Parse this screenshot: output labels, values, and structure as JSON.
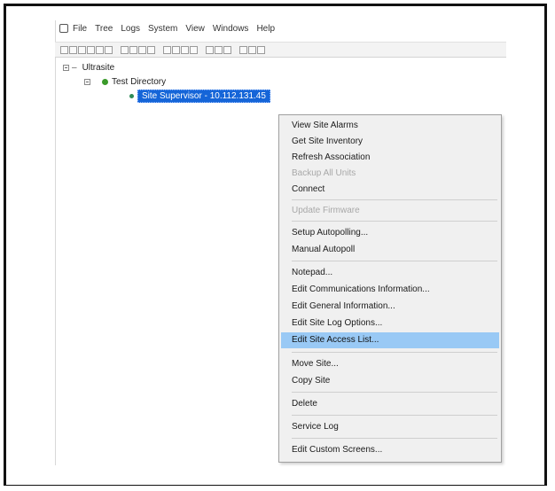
{
  "menubar": {
    "items": [
      "File",
      "Tree",
      "Logs",
      "System",
      "View",
      "Windows",
      "Help"
    ]
  },
  "tree": {
    "root_label": "Ultrasite",
    "folder_label": "Test Directory",
    "selected_label": "Site Supervisor - 10.112.131.45"
  },
  "context_menu": {
    "items": [
      {
        "label": "View Site Alarms",
        "enabled": true
      },
      {
        "label": "Get Site Inventory",
        "enabled": true
      },
      {
        "label": "Refresh Association",
        "enabled": true
      },
      {
        "label": "Backup All Units",
        "enabled": false
      },
      {
        "label": "Connect",
        "enabled": true
      },
      {
        "label": "Update Firmware",
        "enabled": false
      },
      {
        "label": "Setup Autopolling...",
        "enabled": true
      },
      {
        "label": "Manual Autopoll",
        "enabled": true
      },
      {
        "label": "Notepad...",
        "enabled": true
      },
      {
        "label": "Edit Communications Information...",
        "enabled": true
      },
      {
        "label": "Edit General Information...",
        "enabled": true
      },
      {
        "label": "Edit Site Log Options...",
        "enabled": true
      },
      {
        "label": "Edit Site Access List...",
        "enabled": true,
        "highlighted": true
      },
      {
        "label": "Move Site...",
        "enabled": true
      },
      {
        "label": "Copy Site",
        "enabled": true
      },
      {
        "label": "Delete",
        "enabled": true
      },
      {
        "label": "Service Log",
        "enabled": true
      },
      {
        "label": "Edit Custom Screens...",
        "enabled": true
      }
    ]
  },
  "colors": {
    "selection": "#1565d8",
    "menu_highlight": "#99c9f5",
    "status_green": "#3a9a2a"
  }
}
